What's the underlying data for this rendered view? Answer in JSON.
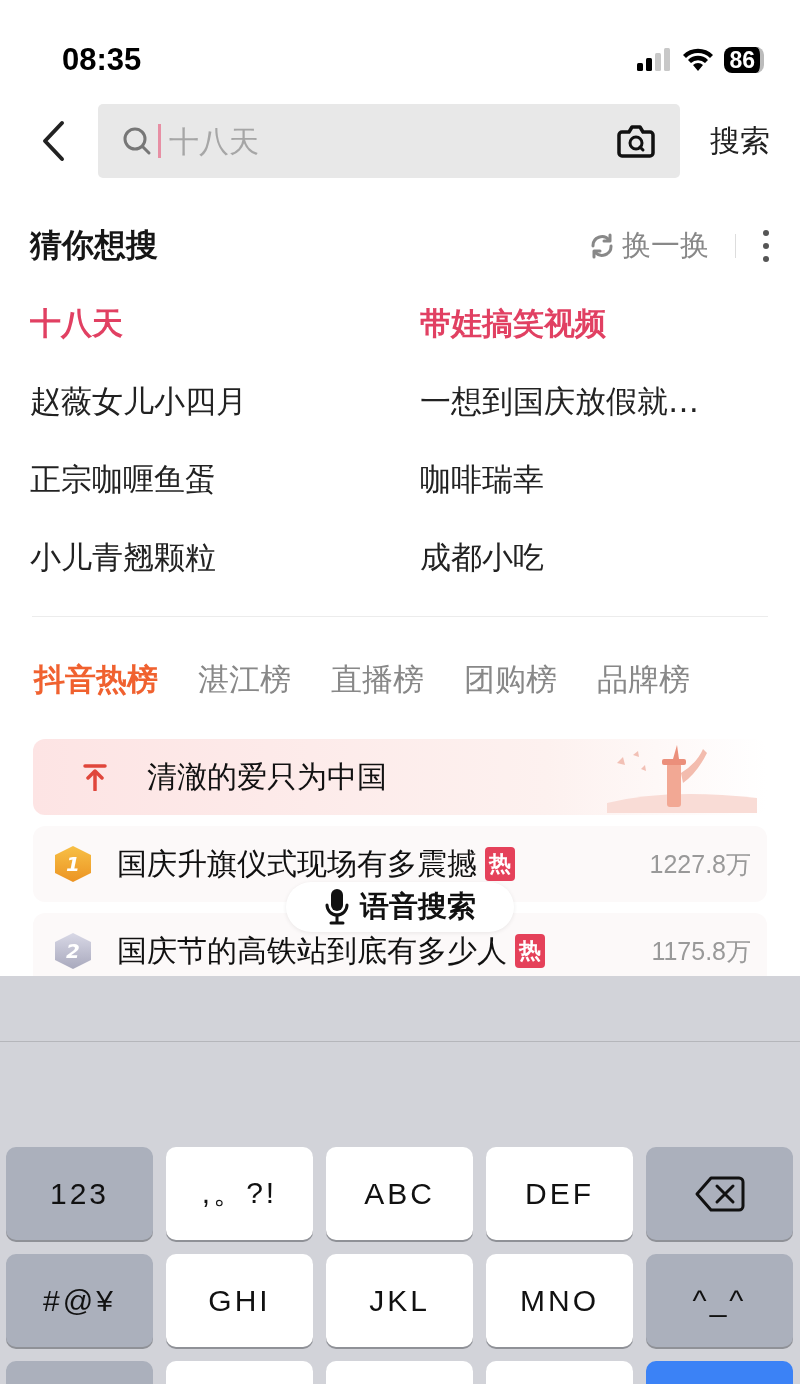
{
  "status_bar": {
    "time": "08:35",
    "battery": "86"
  },
  "search": {
    "placeholder": "十八天",
    "button": "搜索"
  },
  "suggestions": {
    "title": "猜你想搜",
    "refresh": "换一换",
    "items": [
      {
        "text": "十八天",
        "highlight": true
      },
      {
        "text": "带娃搞笑视频",
        "highlight": true
      },
      {
        "text": "赵薇女儿小四月",
        "highlight": false
      },
      {
        "text": "一想到国庆放假就…",
        "highlight": false
      },
      {
        "text": "正宗咖喱鱼蛋",
        "highlight": false
      },
      {
        "text": "咖啡瑞幸",
        "highlight": false
      },
      {
        "text": "小儿青翘颗粒",
        "highlight": false
      },
      {
        "text": "成都小吃",
        "highlight": false
      }
    ]
  },
  "tabs": [
    {
      "label": "抖音热榜",
      "selected": true
    },
    {
      "label": "湛江榜",
      "selected": false
    },
    {
      "label": "直播榜",
      "selected": false
    },
    {
      "label": "团购榜",
      "selected": false
    },
    {
      "label": "品牌榜",
      "selected": false
    }
  ],
  "hot_list": [
    {
      "kind": "pinned",
      "title": "清澈的爱只为中国"
    },
    {
      "kind": "ranked",
      "rank": "1",
      "title": "国庆升旗仪式现场有多震撼",
      "tag": "热",
      "count": "1227.8万"
    },
    {
      "kind": "ranked",
      "rank": "2",
      "title": "国庆节的高铁站到底有多少人",
      "tag": "热",
      "count": "1175.8万"
    }
  ],
  "voice_search": "语音搜索",
  "keyboard": {
    "rows": [
      [
        {
          "kind": "func",
          "label": "123"
        },
        {
          "kind": "char",
          "label": ",。?!"
        },
        {
          "kind": "char",
          "label": "ABC"
        },
        {
          "kind": "char",
          "label": "DEF"
        },
        {
          "kind": "delete"
        }
      ],
      [
        {
          "kind": "func",
          "label": "#@¥"
        },
        {
          "kind": "char",
          "label": "GHI"
        },
        {
          "kind": "char",
          "label": "JKL"
        },
        {
          "kind": "char",
          "label": "MNO"
        },
        {
          "kind": "func",
          "label": "^_^"
        }
      ],
      [
        {
          "kind": "func"
        },
        {
          "kind": "char"
        },
        {
          "kind": "char"
        },
        {
          "kind": "char"
        },
        {
          "kind": "action"
        }
      ]
    ]
  }
}
